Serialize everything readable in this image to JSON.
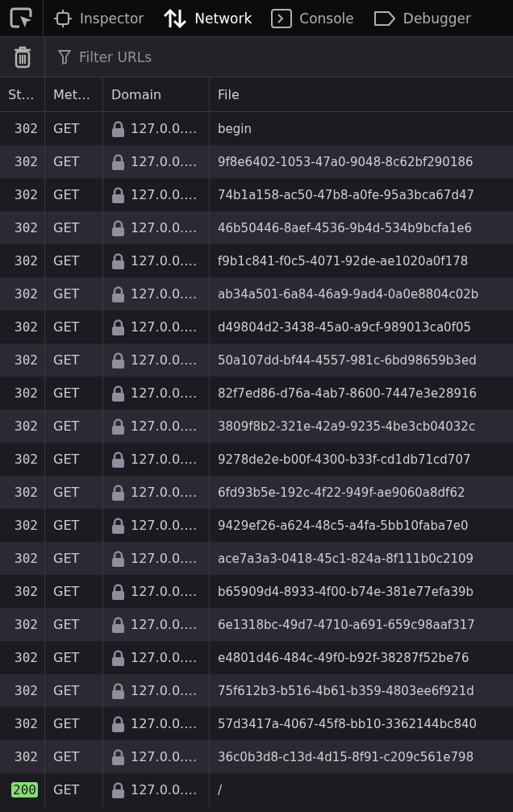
{
  "toolbar": {
    "tabs": [
      {
        "label": "Inspector",
        "kind": "inspector",
        "selected": false
      },
      {
        "label": "Network",
        "kind": "network",
        "selected": true
      },
      {
        "label": "Console",
        "kind": "console",
        "selected": false
      },
      {
        "label": "Debugger",
        "kind": "debugger",
        "selected": false
      }
    ]
  },
  "filter": {
    "placeholder": "Filter URLs"
  },
  "table": {
    "columns": [
      "St…",
      "Met…",
      "Domain",
      "File"
    ],
    "rows": [
      {
        "status": "302",
        "success": false,
        "method": "GET",
        "domain": "127.0.0.…",
        "file": "begin"
      },
      {
        "status": "302",
        "success": false,
        "method": "GET",
        "domain": "127.0.0.…",
        "file": "9f8e6402-1053-47a0-9048-8c62bf290186"
      },
      {
        "status": "302",
        "success": false,
        "method": "GET",
        "domain": "127.0.0.…",
        "file": "74b1a158-ac50-47b8-a0fe-95a3bca67d47"
      },
      {
        "status": "302",
        "success": false,
        "method": "GET",
        "domain": "127.0.0.…",
        "file": "46b50446-8aef-4536-9b4d-534b9bcfa1e6"
      },
      {
        "status": "302",
        "success": false,
        "method": "GET",
        "domain": "127.0.0.…",
        "file": "f9b1c841-f0c5-4071-92de-ae1020a0f178"
      },
      {
        "status": "302",
        "success": false,
        "method": "GET",
        "domain": "127.0.0.…",
        "file": "ab34a501-6a84-46a9-9ad4-0a0e8804c02b"
      },
      {
        "status": "302",
        "success": false,
        "method": "GET",
        "domain": "127.0.0.…",
        "file": "d49804d2-3438-45a0-a9cf-989013ca0f05"
      },
      {
        "status": "302",
        "success": false,
        "method": "GET",
        "domain": "127.0.0.…",
        "file": "50a107dd-bf44-4557-981c-6bd98659b3ed"
      },
      {
        "status": "302",
        "success": false,
        "method": "GET",
        "domain": "127.0.0.…",
        "file": "82f7ed86-d76a-4ab7-8600-7447e3e28916"
      },
      {
        "status": "302",
        "success": false,
        "method": "GET",
        "domain": "127.0.0.…",
        "file": "3809f8b2-321e-42a9-9235-4be3cb04032c"
      },
      {
        "status": "302",
        "success": false,
        "method": "GET",
        "domain": "127.0.0.…",
        "file": "9278de2e-b00f-4300-b33f-cd1db71cd707"
      },
      {
        "status": "302",
        "success": false,
        "method": "GET",
        "domain": "127.0.0.…",
        "file": "6fd93b5e-192c-4f22-949f-ae9060a8df62"
      },
      {
        "status": "302",
        "success": false,
        "method": "GET",
        "domain": "127.0.0.…",
        "file": "9429ef26-a624-48c5-a4fa-5bb10faba7e0"
      },
      {
        "status": "302",
        "success": false,
        "method": "GET",
        "domain": "127.0.0.…",
        "file": "ace7a3a3-0418-45c1-824a-8f111b0c2109"
      },
      {
        "status": "302",
        "success": false,
        "method": "GET",
        "domain": "127.0.0.…",
        "file": "b65909d4-8933-4f00-b74e-381e77efa39b"
      },
      {
        "status": "302",
        "success": false,
        "method": "GET",
        "domain": "127.0.0.…",
        "file": "6e1318bc-49d7-4710-a691-659c98aaf317"
      },
      {
        "status": "302",
        "success": false,
        "method": "GET",
        "domain": "127.0.0.…",
        "file": "e4801d46-484c-49f0-b92f-38287f52be76"
      },
      {
        "status": "302",
        "success": false,
        "method": "GET",
        "domain": "127.0.0.…",
        "file": "75f612b3-b516-4b61-b359-4803ee6f921d"
      },
      {
        "status": "302",
        "success": false,
        "method": "GET",
        "domain": "127.0.0.…",
        "file": "57d3417a-4067-45f8-bb10-3362144bc840"
      },
      {
        "status": "302",
        "success": false,
        "method": "GET",
        "domain": "127.0.0.…",
        "file": "36c0b3d8-c13d-4d15-8f91-c209c561e798"
      },
      {
        "status": "200",
        "success": true,
        "method": "GET",
        "domain": "127.0.0.…",
        "file": "/"
      }
    ]
  }
}
